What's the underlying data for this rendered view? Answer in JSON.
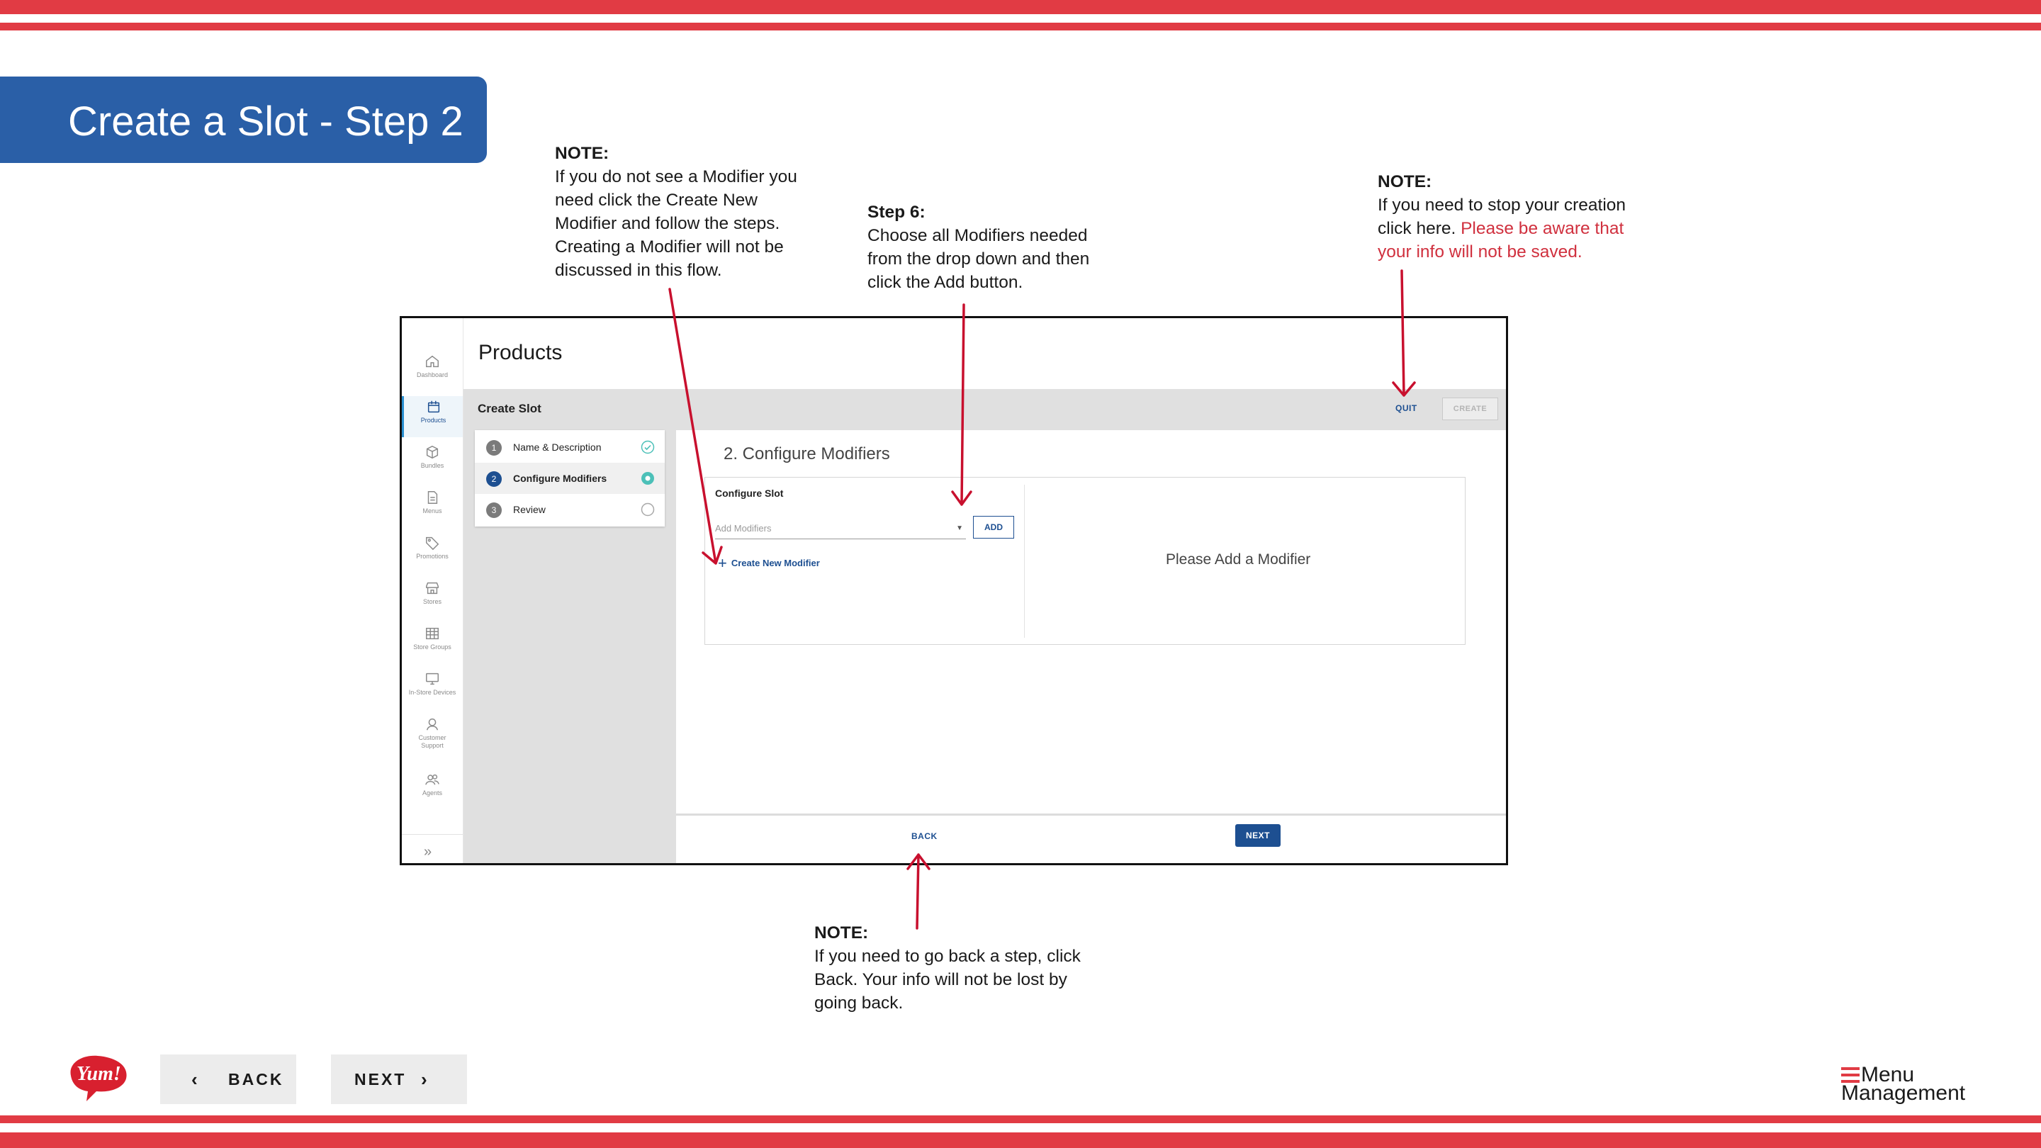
{
  "slide": {
    "title": "Create a Slot - Step 2"
  },
  "notes": {
    "modifier": {
      "head": "NOTE:",
      "lines": [
        "If you do not see a Modifier you",
        "need click the Create New",
        "Modifier and follow the steps.",
        "Creating a Modifier will not be",
        "discussed in this flow."
      ]
    },
    "step6": {
      "head": "Step 6:",
      "lines": [
        "Choose all Modifiers needed",
        "from the drop down and then",
        "click the Add button."
      ]
    },
    "quit": {
      "head": "NOTE:",
      "line1": "If you need to stop your creation",
      "line2_plain": "click here. ",
      "line2_red": "Please be aware that",
      "line3_red": "your info will not be saved."
    },
    "back": {
      "head": "NOTE:",
      "lines": [
        "If you need to go back a step, click",
        "Back. Your info will not be lost by",
        "going back."
      ]
    }
  },
  "app": {
    "page_title": "Products",
    "sidebar": {
      "items": [
        {
          "label": "Dashboard",
          "icon": "home-icon"
        },
        {
          "label": "Products",
          "icon": "box-icon",
          "active": true
        },
        {
          "label": "Bundles",
          "icon": "cube-icon"
        },
        {
          "label": "Menus",
          "icon": "document-icon"
        },
        {
          "label": "Promotions",
          "icon": "tag-icon"
        },
        {
          "label": "Stores",
          "icon": "store-icon"
        },
        {
          "label": "Store Groups",
          "icon": "grid-icon"
        },
        {
          "label": "In-Store Devices",
          "icon": "monitor-icon"
        },
        {
          "label": "Customer Support",
          "icon": "support-icon"
        },
        {
          "label": "Agents",
          "icon": "people-icon"
        }
      ],
      "expand_icon": "chevron-double-right-icon"
    },
    "bar": {
      "title": "Create Slot",
      "quit_label": "QUIT",
      "create_label": "CREATE"
    },
    "steps": [
      {
        "num": "1",
        "label": "Name & Description",
        "status": "complete"
      },
      {
        "num": "2",
        "label": "Configure Modifiers",
        "status": "current"
      },
      {
        "num": "3",
        "label": "Review",
        "status": "pending"
      }
    ],
    "main": {
      "section_title": "2. Configure Modifiers",
      "card_title": "Configure Slot",
      "select_placeholder": "Add Modifiers",
      "add_label": "ADD",
      "create_modifier_label": "Create New Modifier",
      "empty_message": "Please Add a Modifier"
    },
    "footer": {
      "back_label": "BACK",
      "next_label": "NEXT"
    }
  },
  "slide_nav": {
    "back_label": "BACK",
    "next_label": "NEXT"
  },
  "brand": {
    "logo_text": "Yum!",
    "product_line1": "Menu",
    "product_line2": "Management"
  },
  "colors": {
    "accent_red": "#e13b44",
    "banner_blue": "#2a5fa7",
    "app_blue": "#1d4f91",
    "status_teal": "#4cc0b8"
  }
}
